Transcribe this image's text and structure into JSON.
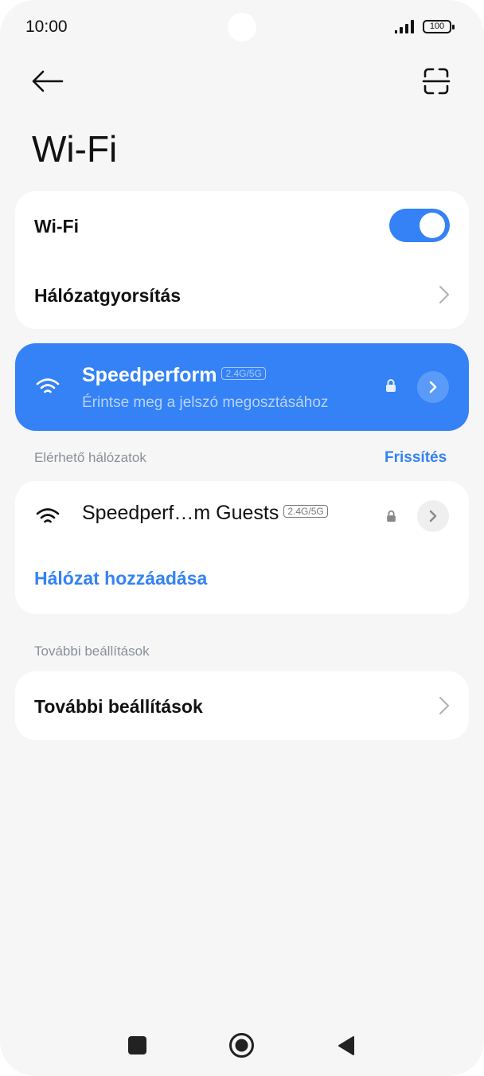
{
  "status_bar": {
    "time": "10:00",
    "battery": "100"
  },
  "header": {
    "title": "Wi-Fi"
  },
  "wifi_card": {
    "wifi_label": "Wi-Fi",
    "wifi_enabled": true,
    "accel_label": "Hálózatgyorsítás"
  },
  "connected": {
    "name": "Speedperform",
    "band": "2.4G/5G",
    "subtitle": "Érintse meg a jelszó megosztásához"
  },
  "available": {
    "section_label": "Elérhető hálózatok",
    "refresh_label": "Frissítés",
    "networks": [
      {
        "name": "Speedperf…m Guests",
        "band": "2.4G/5G"
      }
    ],
    "add_network_label": "Hálózat hozzáadása"
  },
  "more": {
    "section_label": "További beállítások",
    "item_label": "További beállítások"
  },
  "colors": {
    "accent": "#3482f6",
    "background": "#f6f6f6",
    "card": "#ffffff"
  },
  "icons": [
    "back-arrow-icon",
    "scan-icon",
    "wifi-icon",
    "lock-icon",
    "chevron-right-icon",
    "signal-icon",
    "battery-icon"
  ]
}
